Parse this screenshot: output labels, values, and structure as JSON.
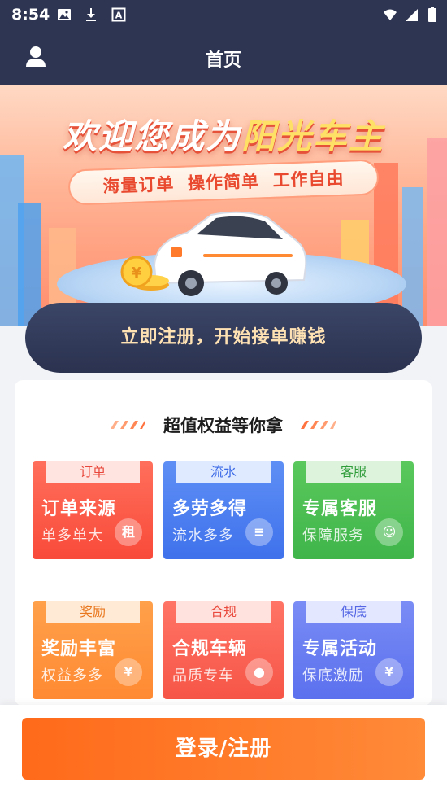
{
  "status_bar": {
    "time": "8:54",
    "icons": [
      "image-icon",
      "download-icon",
      "a-icon",
      "wifi-icon",
      "signal-icon",
      "battery-icon"
    ]
  },
  "header": {
    "title": "首页",
    "left_icon": "user-icon"
  },
  "banner": {
    "title_part1": "欢迎您成为",
    "title_part2": "阳光车主",
    "slogan": "海量订单  操作简单  工作自由"
  },
  "register_button": {
    "label": "立即注册，开始接单赚钱"
  },
  "benefits": {
    "title": "超值权益等你拿",
    "items": [
      {
        "tag": "订单",
        "title": "订单来源",
        "subtitle": "单多单大",
        "badge": "租",
        "color": "#f94a3a"
      },
      {
        "tag": "流水",
        "title": "多劳多得",
        "subtitle": "流水多多",
        "badge": "≡",
        "color": "#3f71ec"
      },
      {
        "tag": "客服",
        "title": "专属客服",
        "subtitle": "保障服务",
        "badge": "☺",
        "color": "#3fb54a"
      },
      {
        "tag": "奖励",
        "title": "奖励丰富",
        "subtitle": "权益多多",
        "badge": "¥",
        "color": "#ff8a33"
      },
      {
        "tag": "合规",
        "title": "合规车辆",
        "subtitle": "品质专车",
        "badge": "●",
        "color": "#f65546"
      },
      {
        "tag": "保底",
        "title": "专属活动",
        "subtitle": "保底激励",
        "badge": "¥",
        "color": "#5b70ee"
      }
    ]
  },
  "login_button": {
    "label": "登录/注册"
  }
}
